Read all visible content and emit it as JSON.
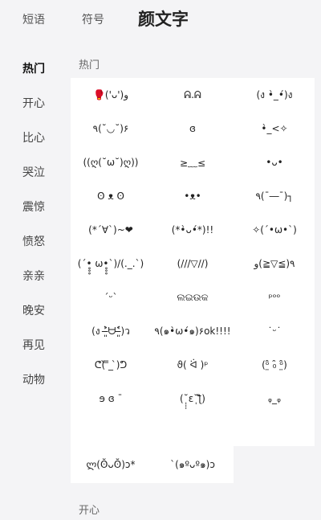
{
  "tabs": [
    {
      "label": "短语"
    },
    {
      "label": "符号"
    },
    {
      "label": "颜文字"
    }
  ],
  "active_tab": "颜文字",
  "sidebar": {
    "items": [
      {
        "label": "热门"
      },
      {
        "label": "开心"
      },
      {
        "label": "比心"
      },
      {
        "label": "哭泣"
      },
      {
        "label": "震惊"
      },
      {
        "label": "愤怒"
      },
      {
        "label": "亲亲"
      },
      {
        "label": "晚安"
      },
      {
        "label": "再见"
      },
      {
        "label": "动物"
      }
    ],
    "active": "热门"
  },
  "sections": [
    {
      "title": "热门"
    },
    {
      "title": "开心"
    }
  ],
  "kaomoji": [
    "🥊('ᴗ')و",
    "ᕱ.ᕱ",
    "(ง •̀_•́)ง",
    "٩(˘◡˘)۶",
    "ɞ",
    "•̀_<✧",
    "((ღ(˘ω˘)ღ))",
    "≥﹏≤",
    "•ᴗ•",
    "ʘ ᴥ ʘ",
    "•ᴥ•",
    "٩(¯―¯)┐",
    "(*´∀`)~❤",
    "(*•̀ᴗ•́*)!!",
    "✧(ˊ•ω•ˋ)",
    "(´•̥̥̥ ω•̥̥̥`)/(._.`)",
    "(///▽//)",
    "٩(≧▽≦)و",
    "ˊᵕˋ",
    "ଲଇଉକ",
    "ᵖᵒᵒ",
    "(ง ˃̶͈̀ᗨ˂̶͈́)ว",
    "٩(๑•̀ω•́๑)۶ok!!!!",
    "˙ᵕ˙",
    "ᕦ(̀ ̿_ ̀)ᕤ",
    "ϑ( ᐛ )ᵖ",
    "(ᵒ̤̑ ₀̑ ᵒ̤̑)",
    "ɘ ɞ ¯",
    "(˘̩̩̩ε˘̩ƪ)",
    "ᵩ_ᵩ",
    "ლ(ʘ̆ᴗʘ̆)ɔ*",
    "`(๑ºᴗº๑)ɔ"
  ]
}
